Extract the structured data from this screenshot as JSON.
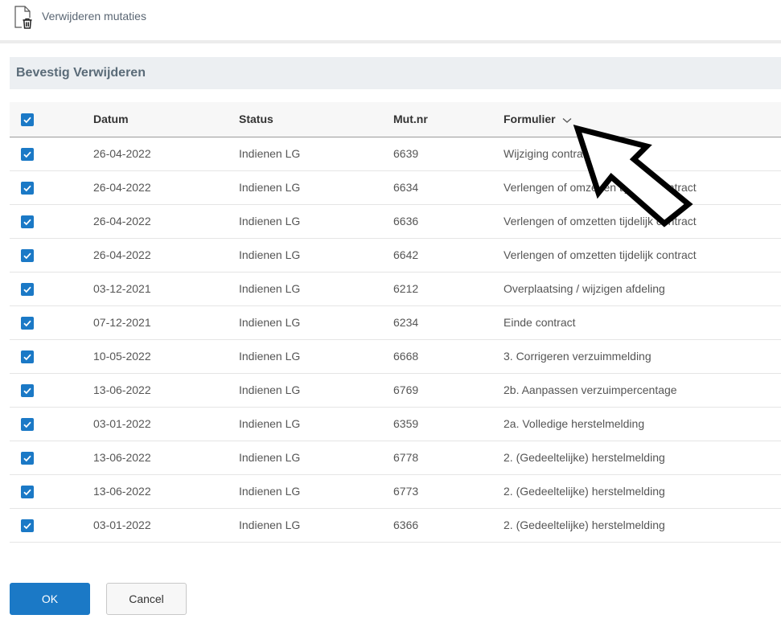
{
  "topbar": {
    "title": "Verwijderen mutaties",
    "icon": "document-trash-icon"
  },
  "section": {
    "title": "Bevestig Verwijderen"
  },
  "table": {
    "headers": {
      "datum": "Datum",
      "status": "Status",
      "mutnr": "Mut.nr",
      "formulier": "Formulier"
    },
    "sort_column": "formulier",
    "rows": [
      {
        "datum": "26-04-2022",
        "status": "Indienen LG",
        "mutnr": "6639",
        "formulier": "Wijziging contract",
        "checked": true
      },
      {
        "datum": "26-04-2022",
        "status": "Indienen LG",
        "mutnr": "6634",
        "formulier": "Verlengen of omzetten tijdelijk contract",
        "checked": true
      },
      {
        "datum": "26-04-2022",
        "status": "Indienen LG",
        "mutnr": "6636",
        "formulier": "Verlengen of omzetten tijdelijk contract",
        "checked": true
      },
      {
        "datum": "26-04-2022",
        "status": "Indienen LG",
        "mutnr": "6642",
        "formulier": "Verlengen of omzetten tijdelijk contract",
        "checked": true
      },
      {
        "datum": "03-12-2021",
        "status": "Indienen LG",
        "mutnr": "6212",
        "formulier": "Overplaatsing / wijzigen afdeling",
        "checked": true
      },
      {
        "datum": "07-12-2021",
        "status": "Indienen LG",
        "mutnr": "6234",
        "formulier": "Einde contract",
        "checked": true
      },
      {
        "datum": "10-05-2022",
        "status": "Indienen LG",
        "mutnr": "6668",
        "formulier": "3. Corrigeren verzuimmelding",
        "checked": true
      },
      {
        "datum": "13-06-2022",
        "status": "Indienen LG",
        "mutnr": "6769",
        "formulier": "2b. Aanpassen verzuimpercentage",
        "checked": true
      },
      {
        "datum": "03-01-2022",
        "status": "Indienen LG",
        "mutnr": "6359",
        "formulier": "2a. Volledige herstelmelding",
        "checked": true
      },
      {
        "datum": "13-06-2022",
        "status": "Indienen LG",
        "mutnr": "6778",
        "formulier": "2. (Gedeeltelijke) herstelmelding",
        "checked": true
      },
      {
        "datum": "13-06-2022",
        "status": "Indienen LG",
        "mutnr": "6773",
        "formulier": "2. (Gedeeltelijke) herstelmelding",
        "checked": true
      },
      {
        "datum": "03-01-2022",
        "status": "Indienen LG",
        "mutnr": "6366",
        "formulier": "2. (Gedeeltelijke) herstelmelding",
        "checked": true
      }
    ]
  },
  "buttons": {
    "ok": "OK",
    "cancel": "Cancel"
  },
  "colors": {
    "accent": "#1b79c6",
    "section_bg": "#eceff2",
    "header_bg": "#f7f7f7"
  }
}
